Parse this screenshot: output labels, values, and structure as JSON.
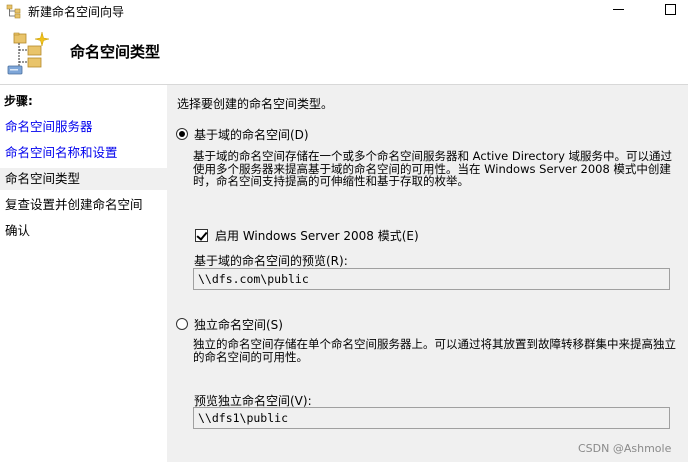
{
  "window": {
    "title": "新建命名空间向导",
    "app_icon": "namespace-wizard-icon"
  },
  "header": {
    "title": "命名空间类型",
    "icon": "namespace-tree-icon"
  },
  "sidebar": {
    "heading": "步骤:",
    "steps": [
      {
        "label": "命名空间服务器",
        "state": "link"
      },
      {
        "label": "命名空间名称和设置",
        "state": "link"
      },
      {
        "label": "命名空间类型",
        "state": "current"
      },
      {
        "label": "复查设置并创建命名空间",
        "state": "plain"
      },
      {
        "label": "确认",
        "state": "plain"
      }
    ]
  },
  "main": {
    "instruction": "选择要创建的命名空间类型。",
    "domain_option": {
      "label": "基于域的命名空间(D)",
      "selected": true,
      "description": "基于域的命名空间存储在一个或多个命名空间服务器和 Active Directory 域服务中。可以通过使用多个服务器来提高基于域的命名空间的可用性。当在 Windows Server 2008 模式中创建时，命名空间支持提高的可伸缩性和基于存取的枚举。"
    },
    "ws2008_mode": {
      "label": "启用 Windows Server 2008 模式(E)",
      "checked": true
    },
    "domain_preview": {
      "label": "基于域的命名空间的预览(R):",
      "value": "\\\\dfs.com\\public"
    },
    "standalone_option": {
      "label": "独立命名空间(S)",
      "selected": false,
      "description": "独立的命名空间存储在单个命名空间服务器上。可以通过将其放置到故障转移群集中来提高独立的命名空间的可用性。"
    },
    "standalone_preview": {
      "label": "预览独立命名空间(V):",
      "value": "\\\\dfs1\\public"
    }
  },
  "watermark": "CSDN @Ashmole",
  "colors": {
    "link": "#0000ee",
    "window_bg": "#f0f0f0",
    "panel_bg": "#ffffff"
  }
}
